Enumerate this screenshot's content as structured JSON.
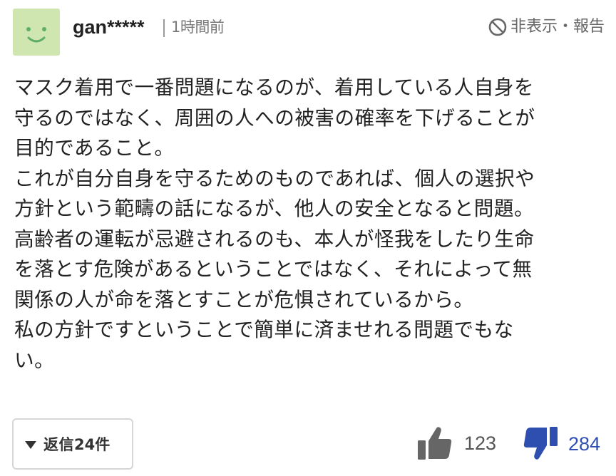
{
  "comment": {
    "username": "gan*****",
    "time_ago": "1時間前",
    "report_label": "非表示・報告",
    "body_lines": [
      "マスク着用で一番問題になるのが、着用している人自身を",
      "守るのではなく、周囲の人への被害の確率を下げることが",
      "目的であること。",
      "これが自分自身を守るためのものであれば、個人の選択や",
      "方針という範疇の話になるが、他人の安全となると問題。",
      "高齢者の運転が忌避されるのも、本人が怪我をしたり生命",
      "を落とす危険があるということではなく、それによって無",
      "関係の人が命を落とすことが危惧されているから。",
      "私の方針ですということで簡単に済ませれる問題でもな",
      "い。"
    ],
    "reply": {
      "label": "返信",
      "count": "24件"
    },
    "likes": {
      "count": "123"
    },
    "dislikes": {
      "count": "284"
    }
  },
  "colors": {
    "avatar_bg": "#cfe6b1",
    "avatar_face": "#5fae68",
    "text": "#222222",
    "muted": "#7a7a7a",
    "like_icon": "#666666",
    "dislike_icon": "#2f4fb0"
  },
  "icons": {
    "avatar": "smiley-face-icon",
    "report": "prohibited-icon",
    "reply_toggle": "triangle-down-icon",
    "like": "thumbs-up-icon",
    "dislike": "thumbs-down-icon"
  }
}
